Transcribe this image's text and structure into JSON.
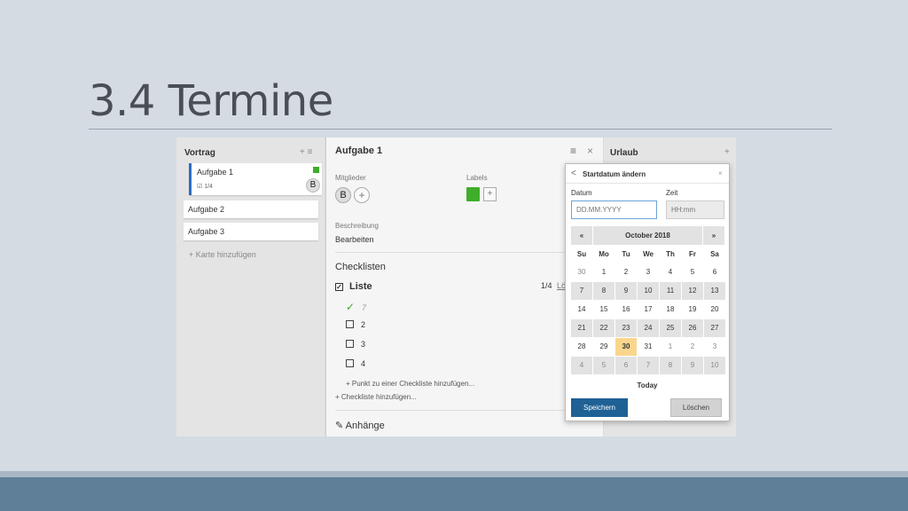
{
  "slide": {
    "title": "3.4 Termine"
  },
  "colors": {
    "accent_green": "#3fae2a",
    "save_button": "#1f6195",
    "today_highlight": "#fad68c",
    "footer": "#5f7f98"
  },
  "left_list": {
    "title": "Vortrag",
    "tools": "+ ≡",
    "cards": [
      {
        "title": "Aufgabe 1",
        "badge": "☑ 1/4",
        "member": "B"
      },
      {
        "title": "Aufgabe 2"
      },
      {
        "title": "Aufgabe 3"
      }
    ],
    "add_card": "+ Karte hinzufügen"
  },
  "detail": {
    "title": "Aufgabe 1",
    "menu_icon": "≡",
    "close_icon": "×",
    "members_label": "Mitglieder",
    "member_initial": "B",
    "add_icon": "+",
    "labels_label": "Labels",
    "description_label": "Beschreibung",
    "description_value": "Bearbeiten",
    "checklists_label": "Checklisten",
    "checklist": {
      "name": "Liste",
      "count": "1/4",
      "delete": "Lö",
      "items": [
        {
          "text": "7",
          "done": true
        },
        {
          "text": "2",
          "done": false
        },
        {
          "text": "3",
          "done": false
        },
        {
          "text": "4",
          "done": false
        }
      ],
      "add_item": "+ Punkt zu einer Checkliste hinzufügen...",
      "add_checklist": "+ Checkliste hinzufügen..."
    },
    "attachments_label": "Anhänge"
  },
  "right_list": {
    "title": "Urlaub",
    "plus": "+"
  },
  "datepicker": {
    "title": "Startdatum ändern",
    "back": "<",
    "close": "×",
    "date_label": "Datum",
    "date_placeholder": "DD.MM.YYYY",
    "time_label": "Zeit",
    "time_placeholder": "HH:mm",
    "prev": "«",
    "month": "October 2018",
    "next": "»",
    "weekdays": [
      "Su",
      "Mo",
      "Tu",
      "We",
      "Th",
      "Fr",
      "Sa"
    ],
    "weeks": [
      [
        "30",
        "1",
        "2",
        "3",
        "4",
        "5",
        "6"
      ],
      [
        "7",
        "8",
        "9",
        "10",
        "11",
        "12",
        "13"
      ],
      [
        "14",
        "15",
        "16",
        "17",
        "18",
        "19",
        "20"
      ],
      [
        "21",
        "22",
        "23",
        "24",
        "25",
        "26",
        "27"
      ],
      [
        "28",
        "29",
        "30",
        "31",
        "1",
        "2",
        "3"
      ],
      [
        "4",
        "5",
        "6",
        "7",
        "8",
        "9",
        "10"
      ]
    ],
    "today_label": "Today",
    "save": "Speichern",
    "delete": "Löschen"
  }
}
